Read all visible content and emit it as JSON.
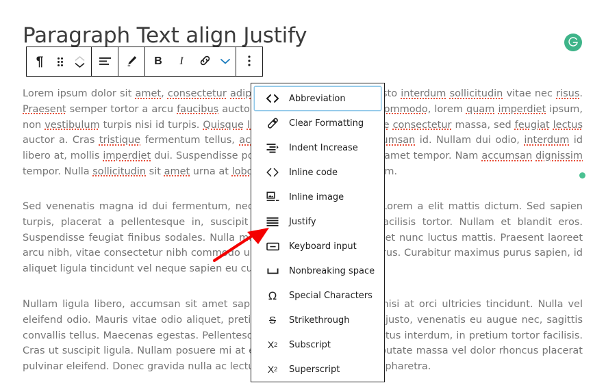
{
  "document": {
    "title": "Paragraph Text align Justify"
  },
  "toolbar": {
    "buttons": [
      {
        "name": "paragraph-block-type",
        "icon": "pilcrow-icon",
        "label": "¶"
      },
      {
        "name": "drag-handle",
        "icon": "drag-dots-icon",
        "label": ""
      },
      {
        "name": "move-up",
        "icon": "chevron-up-icon",
        "label": ""
      },
      {
        "name": "move-down",
        "icon": "chevron-down-icon",
        "label": ""
      },
      {
        "name": "align-text",
        "icon": "align-left-icon",
        "label": ""
      },
      {
        "name": "highlight",
        "icon": "marker-pen-icon",
        "label": ""
      },
      {
        "name": "bold",
        "icon": "bold-icon",
        "label": "B"
      },
      {
        "name": "italic",
        "icon": "italic-icon",
        "label": "I"
      },
      {
        "name": "link",
        "icon": "link-icon",
        "label": ""
      },
      {
        "name": "more-rich-text",
        "icon": "chevron-down-icon",
        "label": ""
      },
      {
        "name": "block-options",
        "icon": "kebab-menu-icon",
        "label": ""
      }
    ],
    "more_button_active_color": "#1a7bbd"
  },
  "format_menu": {
    "items": [
      {
        "label": "Abbreviation",
        "icon": "abbreviation-code-icon",
        "focused": true
      },
      {
        "label": "Clear Formatting",
        "icon": "eraser-icon",
        "focused": false
      },
      {
        "label": "Indent Increase",
        "icon": "indent-increase-icon",
        "focused": false
      },
      {
        "label": "Inline code",
        "icon": "inline-code-icon",
        "focused": false
      },
      {
        "label": "Inline image",
        "icon": "inline-image-icon",
        "focused": false
      },
      {
        "label": "Justify",
        "icon": "justify-icon",
        "focused": false
      },
      {
        "label": "Keyboard input",
        "icon": "keyboard-icon",
        "focused": false
      },
      {
        "label": "Nonbreaking space",
        "icon": "nonbreaking-space-icon",
        "focused": false
      },
      {
        "label": "Special Characters",
        "icon": "omega-icon",
        "focused": false
      },
      {
        "label": "Strikethrough",
        "icon": "strikethrough-icon",
        "focused": false
      },
      {
        "label": "Subscript",
        "icon": "subscript-icon",
        "focused": false
      },
      {
        "label": "Superscript",
        "icon": "superscript-icon",
        "focused": false
      }
    ],
    "focus_outline_color": "#8ec7e8"
  },
  "content": {
    "paragraphs": [
      "Lorem ipsum dolor sit amet, consectetur adipiscing elit. Sed sit amet justo interdum sollicitudin vitae nec risus. Praesent semper tortor a arcu faucibus auctor. Maecenas sagittis urna commodo, lorem quam imperdiet ipsum, non vestibulum turpis nisi id turpis. Quisque luctus nec lectus et tristique consectetur massa, sed feugiat lectus auctor a. Cras tristique fermentum tellus, accumsan dapibus urna accumsan id. Nullam dui odio, interdum id libero at, mollis imperdiet dui. Suspendisse potenti. Quisque nec nisl sit amet tortor. Nam accumsan dignissim tempor. Nulla sollicitudin sit amet urna at lobortis. Nunc nec gravida lorem.",
      "Sed venenatis magna id dui fermentum, nec rhoncus nunc pharetra. Lorem a elit mattis dictum. Sed sapien turpis, placerat a pellentesque in, suscipit et lorem. Curabitur at facilisis tortor. Nullam et blandit eros. Suspendisse feugiat finibus sodales. Nulla malesuada volutpat lacus eget nunc luctus mattis. Praesent laoreet arcu nibh, vitae consectetur nibh commodo urna. Integer at volutpat purus. Curabitur maximus purus sapien, id aliquet ligula tincidunt vel neque sapien eu cursus.",
      "Nullam ligula libero, accumsan sit amet sapien at, rhoncus maximus nisi at orci ultricies tincidunt. Nulla vel eleifend odio. Mauris vitae odio aliquet, pretium est. Vestibulum turpis justo, venenatis eu augue nec, sagittis convallis tellus. Maecenas egestas. Pellentesque sagittis neque eget metus interdum, in pretium tortor facilisis. Cras ut suscipit ligula. Nullam posuere mi at eleifend efficitur. Nulla vulputate massa vel dolor rhoncus placerat pulvinar eleifend. Donec gravida nulla ac lectus blandit, et facilisis lacus pharetra."
    ],
    "text_color": "#757575",
    "spellcheck_underline_color": "#e8503a"
  },
  "grammarly": {
    "badge_label": "G",
    "badge_color": "#3eb489",
    "inline_dot_color": "#4bc192"
  },
  "annotation": {
    "arrow_color": "#f40000",
    "points_to": "Justify"
  }
}
